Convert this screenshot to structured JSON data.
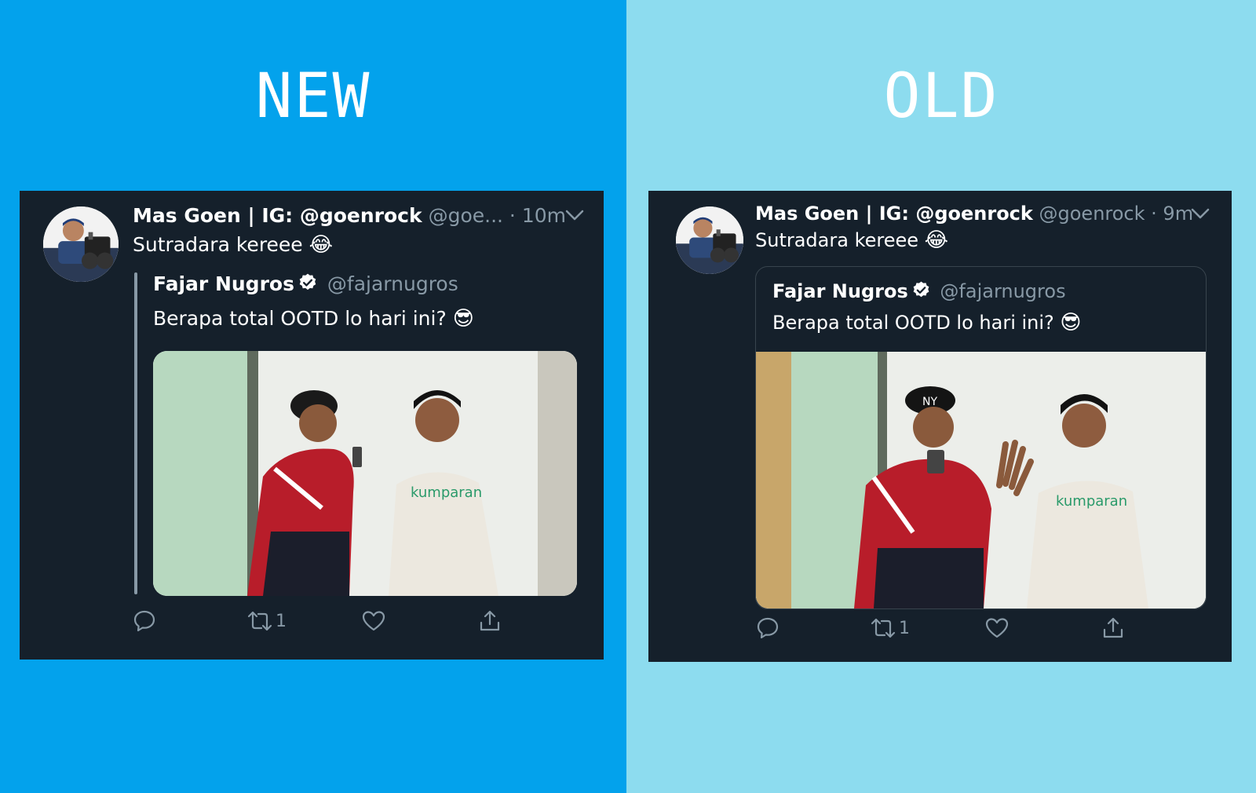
{
  "colors": {
    "new_background": "#03a2ec",
    "old_background": "#8ddcef",
    "card_background": "#15202b",
    "secondary_text": "#8899a6",
    "verified_badge": "#ffffff"
  },
  "panels": {
    "new": {
      "label": "NEW",
      "tweet": {
        "display_name": "Mas Goen | IG: @goenrock",
        "handle": "@goe...",
        "separator": " · ",
        "time": "10m",
        "text": "Sutradara kereee",
        "emoji": "😂",
        "quote": {
          "display_name": "Fajar Nugros",
          "handle": "@fajarnugros",
          "text": "Berapa total OOTD lo hari ini?",
          "emoji": "😎"
        },
        "retweet_count": "1"
      }
    },
    "old": {
      "label": "OLD",
      "tweet": {
        "display_name": "Mas Goen | IG: @goenrock",
        "handle": "@goenrock",
        "separator": " · ",
        "time": "9m",
        "text": "Sutradara kereee",
        "emoji": "😂",
        "quote": {
          "display_name": "Fajar Nugros",
          "handle": "@fajarnugros",
          "text": "Berapa total OOTD lo hari ini?",
          "emoji": "😎"
        },
        "retweet_count": "1"
      }
    }
  },
  "icons": {
    "avatar": "profile-photo",
    "caret": "chevron-down-icon",
    "verified": "verified-badge-icon",
    "reply": "reply-icon",
    "retweet": "retweet-icon",
    "like": "heart-icon",
    "share": "share-icon",
    "media": "video-thumbnail"
  }
}
